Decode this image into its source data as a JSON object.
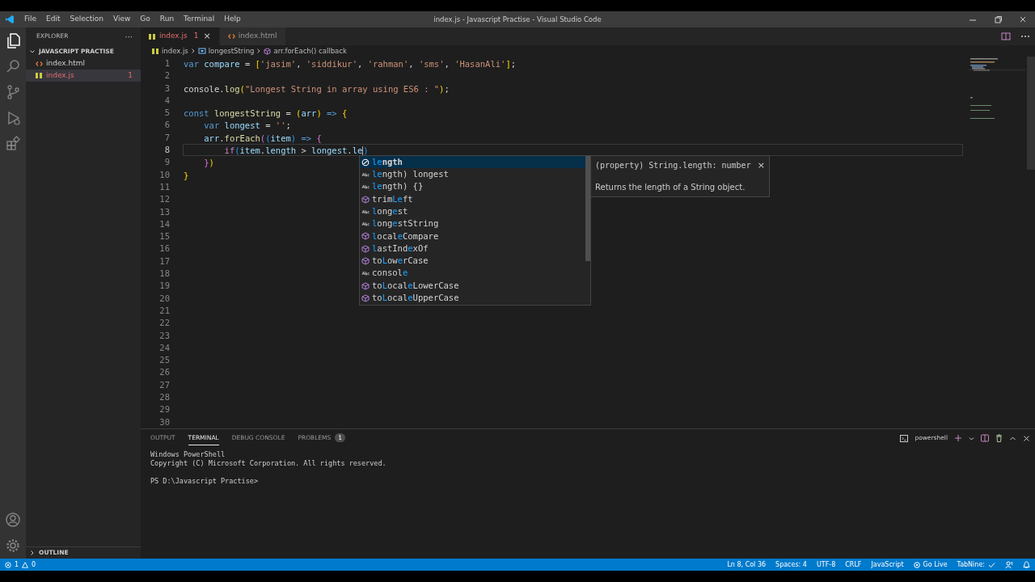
{
  "window": {
    "title": "index.js - Javascript Practise - Visual Studio Code"
  },
  "menu": [
    "File",
    "Edit",
    "Selection",
    "View",
    "Go",
    "Run",
    "Terminal",
    "Help"
  ],
  "activity_bar": [
    {
      "kind": "files",
      "selected": true
    },
    {
      "kind": "search",
      "selected": false
    },
    {
      "kind": "source-control",
      "selected": false
    },
    {
      "kind": "run",
      "selected": false
    },
    {
      "kind": "extensions",
      "selected": false
    }
  ],
  "sidebar": {
    "title": "EXPLORER",
    "more": "···",
    "folder": {
      "label": "JAVASCRIPT PRACTISE",
      "expanded": true,
      "children": [
        {
          "label": "index.html",
          "kind": "html",
          "selected": false
        },
        {
          "label": "index.js",
          "kind": "js",
          "selected": true,
          "problems": "1"
        }
      ]
    },
    "outline": {
      "label": "OUTLINE",
      "expanded": false
    }
  },
  "tabs": [
    {
      "label": "index.js",
      "kind": "js",
      "selected": true,
      "problems": "1",
      "close": "×"
    },
    {
      "label": "index.html",
      "kind": "html",
      "selected": false
    }
  ],
  "breadcrumb": [
    {
      "label": "index.js",
      "kind": "js"
    },
    {
      "label": "longestString",
      "kind": "variable"
    },
    {
      "label": "arr.forEach() callback",
      "kind": "method"
    }
  ],
  "code": [
    {
      "number": "1",
      "current": false,
      "tokens": [
        {
          "kind": "keyword",
          "text": "var "
        },
        {
          "kind": "variable",
          "text": "compare"
        },
        {
          "kind": "plain",
          "text": " = "
        },
        {
          "kind": "bracket",
          "text": "["
        },
        {
          "kind": "string",
          "text": "'jasim'"
        },
        {
          "kind": "plain",
          "text": ", "
        },
        {
          "kind": "string",
          "text": "'siddikur'"
        },
        {
          "kind": "plain",
          "text": ", "
        },
        {
          "kind": "string",
          "text": "'rahman'"
        },
        {
          "kind": "plain",
          "text": ", "
        },
        {
          "kind": "string",
          "text": "'sms'"
        },
        {
          "kind": "plain",
          "text": ", "
        },
        {
          "kind": "string",
          "text": "'HasanAli'"
        },
        {
          "kind": "bracket",
          "text": "]"
        },
        {
          "kind": "plain",
          "text": ";"
        }
      ]
    },
    {
      "number": "2",
      "current": false
    },
    {
      "number": "3",
      "current": false,
      "tokens": [
        {
          "kind": "plain",
          "text": "console."
        },
        {
          "kind": "function",
          "text": "log"
        },
        {
          "kind": "bracket",
          "text": "("
        },
        {
          "kind": "string",
          "text": "\"Longest String in array using ES6 : \""
        },
        {
          "kind": "bracket",
          "text": ")"
        },
        {
          "kind": "plain",
          "text": ";"
        }
      ]
    },
    {
      "number": "4",
      "current": false
    },
    {
      "number": "5",
      "current": false,
      "tokens": [
        {
          "kind": "keyword",
          "text": "const "
        },
        {
          "kind": "function",
          "text": "longestString"
        },
        {
          "kind": "plain",
          "text": " = "
        },
        {
          "kind": "bracket",
          "text": "("
        },
        {
          "kind": "variable",
          "text": "arr"
        },
        {
          "kind": "bracket",
          "text": ")"
        },
        {
          "kind": "keyword",
          "text": " => "
        },
        {
          "kind": "bracket",
          "text": "{"
        }
      ]
    },
    {
      "number": "6",
      "current": false,
      "tokens": [
        {
          "kind": "keyword",
          "text": "    var "
        },
        {
          "kind": "variable",
          "text": "longest"
        },
        {
          "kind": "plain",
          "text": " = "
        },
        {
          "kind": "string",
          "text": "''"
        },
        {
          "kind": "plain",
          "text": ";"
        }
      ]
    },
    {
      "number": "7",
      "current": false,
      "tokens": [
        {
          "kind": "variable",
          "text": "    arr"
        },
        {
          "kind": "plain",
          "text": "."
        },
        {
          "kind": "function",
          "text": "forEach"
        },
        {
          "kind": "bracket2",
          "text": "("
        },
        {
          "kind": "bracket3",
          "text": "("
        },
        {
          "kind": "variable",
          "text": "item"
        },
        {
          "kind": "bracket3",
          "text": ")"
        },
        {
          "kind": "keyword",
          "text": " => "
        },
        {
          "kind": "bracket2",
          "text": "{"
        }
      ]
    },
    {
      "number": "8",
      "current": true,
      "tokens": [
        {
          "kind": "control",
          "text": "        if"
        },
        {
          "kind": "bracket3",
          "text": "("
        },
        {
          "kind": "variable",
          "text": "item"
        },
        {
          "kind": "plain",
          "text": "."
        },
        {
          "kind": "variable",
          "text": "length"
        },
        {
          "kind": "plain",
          "text": " > "
        },
        {
          "kind": "variable",
          "text": "longest"
        },
        {
          "kind": "plain",
          "text": "."
        },
        {
          "kind": "variable",
          "text": "le"
        },
        {
          "kind": "bracket3",
          "text": ")"
        }
      ]
    },
    {
      "number": "9",
      "current": false,
      "tokens": [
        {
          "kind": "bracket2",
          "text": "    }"
        },
        {
          "kind": "bracket",
          "text": ")"
        }
      ]
    },
    {
      "number": "10",
      "current": false,
      "tokens": [
        {
          "kind": "bracket",
          "text": "}"
        }
      ]
    },
    {
      "number": "11",
      "current": false
    },
    {
      "number": "12",
      "current": false
    },
    {
      "number": "13",
      "current": false
    },
    {
      "number": "14",
      "current": false
    },
    {
      "number": "15",
      "current": false
    },
    {
      "number": "16",
      "current": false
    },
    {
      "number": "17",
      "current": false
    },
    {
      "number": "18",
      "current": false
    },
    {
      "number": "19",
      "current": false
    },
    {
      "number": "20",
      "current": false
    },
    {
      "number": "21",
      "current": false
    },
    {
      "number": "22",
      "current": false
    },
    {
      "number": "23",
      "current": false
    },
    {
      "number": "24",
      "current": false
    },
    {
      "number": "25",
      "current": false
    },
    {
      "number": "26",
      "current": false
    },
    {
      "number": "27",
      "current": false
    },
    {
      "number": "28",
      "current": false
    },
    {
      "number": "29",
      "current": false
    },
    {
      "number": "30",
      "current": false
    }
  ],
  "suggestions": {
    "items": [
      {
        "label": "**le**ngth",
        "kind": "property",
        "selected": true
      },
      {
        "label": "**le**ngth) longest",
        "kind": "word",
        "selected": false
      },
      {
        "label": "**le**ngth) {}",
        "kind": "word",
        "selected": false
      },
      {
        "label": "trim**Le**ft",
        "kind": "method",
        "selected": false
      },
      {
        "label": "**l**ong**e**st",
        "kind": "word",
        "selected": false
      },
      {
        "label": "**l**ong**e**stString",
        "kind": "word",
        "selected": false
      },
      {
        "label": "**l**ocal**e**Compare",
        "kind": "method",
        "selected": false
      },
      {
        "label": "**l**astInd**e**xOf",
        "kind": "method",
        "selected": false
      },
      {
        "label": "to**L**ow**e**rCase",
        "kind": "method",
        "selected": false
      },
      {
        "label": "consol**e**",
        "kind": "word",
        "selected": false
      },
      {
        "label": "to**L**ocal**e**LowerCase",
        "kind": "method",
        "selected": false
      },
      {
        "label": "to**L**ocal**e**UpperCase",
        "kind": "method",
        "selected": false
      }
    ],
    "detail": {
      "signature": "(property) String.length: number",
      "close": "×",
      "description": "Returns the length of a String object."
    }
  },
  "panel": {
    "tabs": [
      {
        "label": "OUTPUT",
        "selected": false
      },
      {
        "label": "TERMINAL",
        "selected": true
      },
      {
        "label": "DEBUG CONSOLE",
        "selected": false
      },
      {
        "label": "PROBLEMS",
        "selected": false,
        "count": "1"
      }
    ],
    "shell": "powershell",
    "terminal": [
      "Windows PowerShell",
      "Copyright (C) Microsoft Corporation. All rights reserved.",
      "PS D:\\Javascript Practise>"
    ]
  },
  "status_bar": {
    "errors": "1",
    "warnings": "0",
    "items": [
      "Ln 8, Col 36",
      "Spaces: 4",
      "UTF-8",
      "CRLF",
      "JavaScript"
    ],
    "go_live": "Go Live",
    "tabnine": "TabNine:"
  }
}
